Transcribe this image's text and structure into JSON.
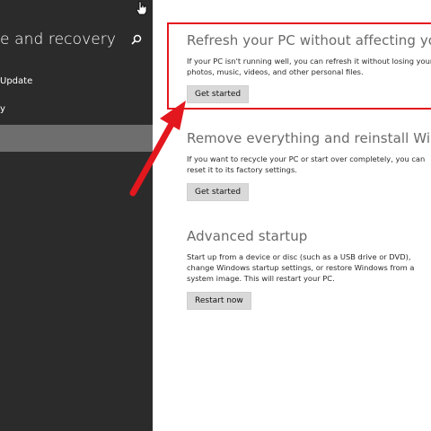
{
  "sidebar": {
    "title": "e and recovery",
    "items": [
      {
        "label": "Update"
      },
      {
        "label": "y"
      },
      {
        "label": ""
      }
    ]
  },
  "sections": [
    {
      "title": "Refresh your PC without affecting your files",
      "text": "If your PC isn't running well, you can refresh it without losing your photos, music, videos, and other personal files.",
      "button": "Get started"
    },
    {
      "title": "Remove everything and reinstall Windows",
      "text": "If you want to recycle your PC or start over completely, you can reset it to its factory settings.",
      "button": "Get started"
    },
    {
      "title": "Advanced startup",
      "text": "Start up from a device or disc (such as a USB drive or DVD), change Windows startup settings, or restore Windows from a system image. This will restart your PC.",
      "button": "Restart now"
    }
  ],
  "icons": {
    "search": "search-icon",
    "cursor": "hand-cursor-icon",
    "arrow": "red-arrow-icon"
  },
  "colors": {
    "sidebar_bg": "#2b2b2b",
    "selected_bg": "#6e6e6e",
    "highlight": "#e3171e"
  }
}
